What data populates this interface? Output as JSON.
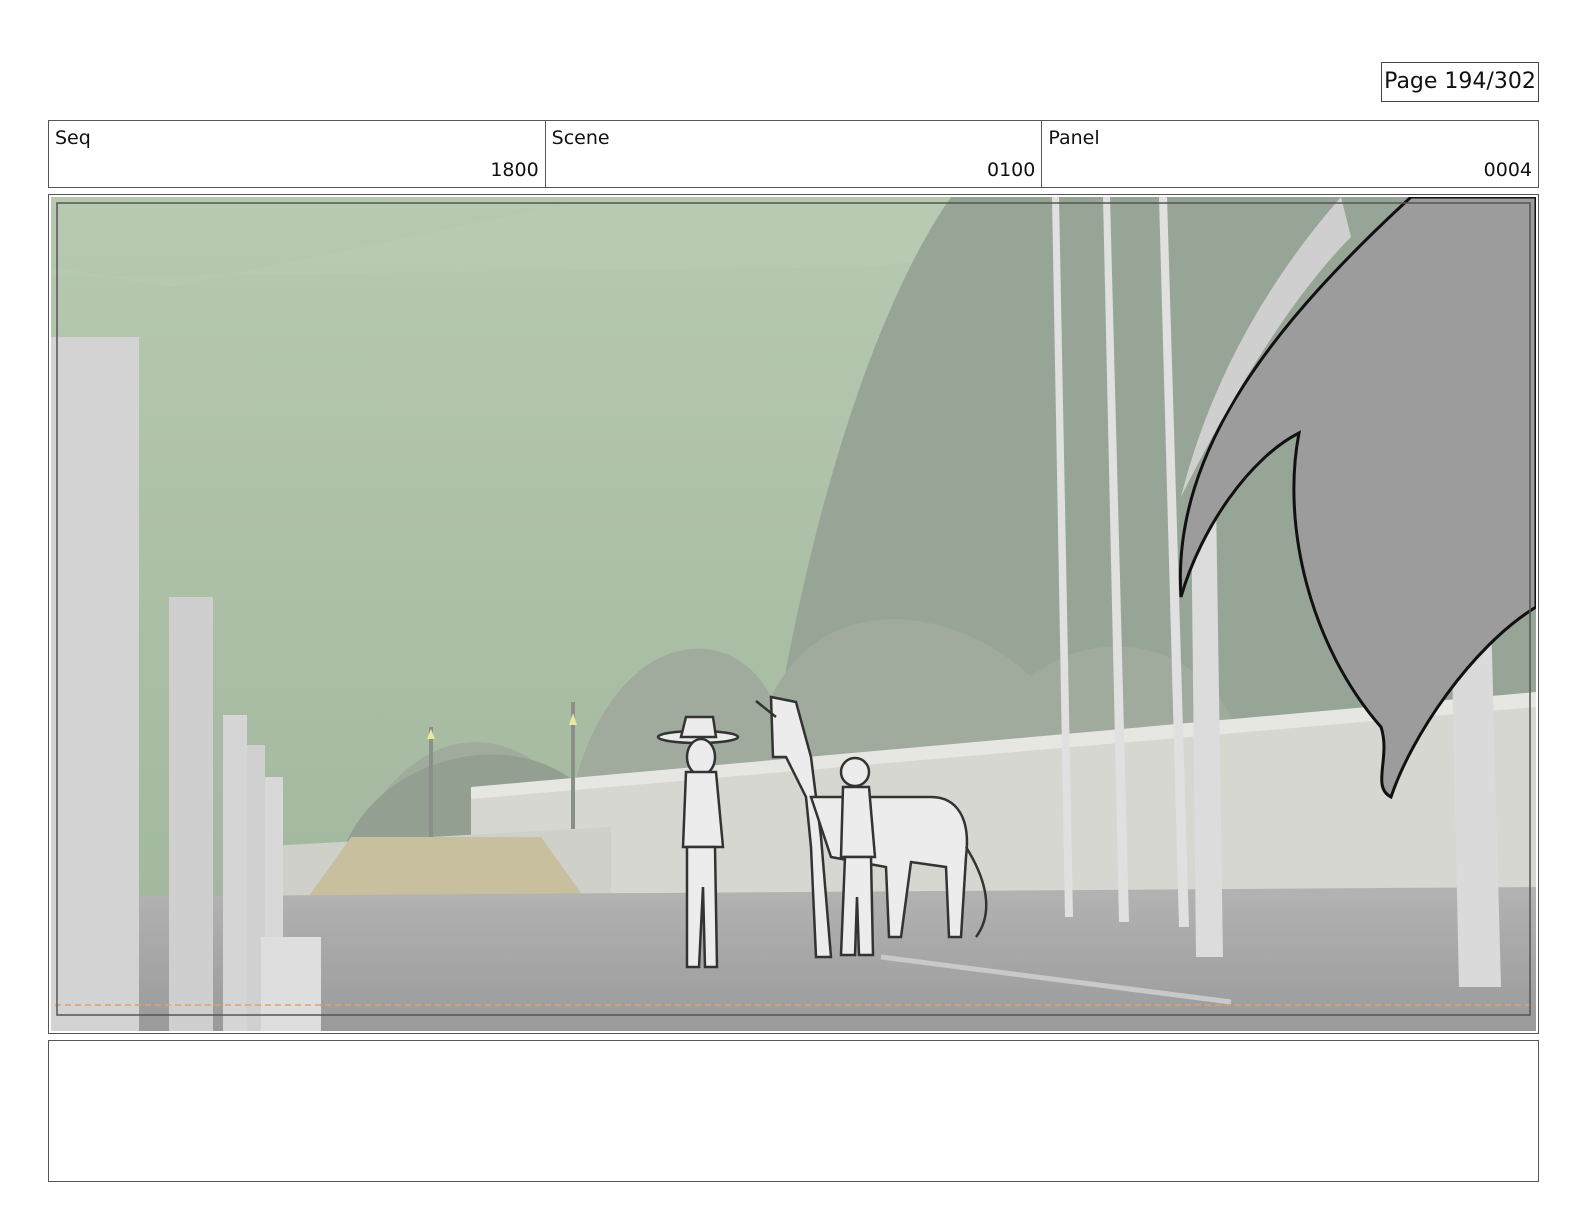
{
  "page": {
    "label": "Page 194/302"
  },
  "header": {
    "seq": {
      "label": "Seq",
      "value": "1800"
    },
    "scene": {
      "label": "Scene",
      "value": "0100"
    },
    "panel": {
      "label": "Panel",
      "value": "0004"
    }
  },
  "notes": {
    "text": ""
  },
  "colors": {
    "sky": "#a9bca2",
    "hill": "#9aa99a",
    "ground": "#a6a6a6",
    "wall": "#d9d9d4",
    "cape": "#9a9a9a"
  }
}
